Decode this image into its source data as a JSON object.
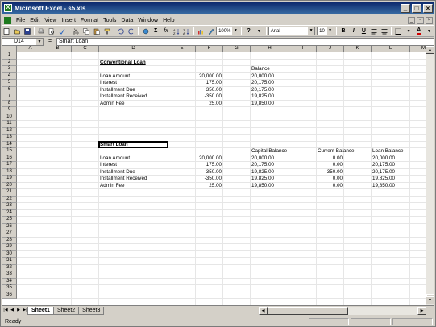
{
  "window": {
    "title": "Microsoft Excel - s5.xls",
    "app_icon": "X"
  },
  "menu": [
    "File",
    "Edit",
    "View",
    "Insert",
    "Format",
    "Tools",
    "Data",
    "Window",
    "Help"
  ],
  "toolbar": {
    "zoom": "100%",
    "font": "Arial",
    "size": "10",
    "help": "?"
  },
  "formula": {
    "name_box": "D14",
    "eq": "=",
    "content": "Smart Loan"
  },
  "columns": [
    "A",
    "B",
    "C",
    "D",
    "E",
    "F",
    "G",
    "H",
    "I",
    "J",
    "K",
    "L",
    "M",
    "N"
  ],
  "rows": [
    "1",
    "2",
    "3",
    "4",
    "5",
    "6",
    "7",
    "8",
    "9",
    "10",
    "11",
    "12",
    "13",
    "14",
    "15",
    "16",
    "17",
    "18",
    "19",
    "20",
    "21",
    "22",
    "23",
    "24",
    "25",
    "26",
    "27",
    "28",
    "29",
    "30",
    "31",
    "32",
    "33",
    "34",
    "35",
    "36"
  ],
  "cells": [
    {
      "row": 2,
      "col": "D",
      "text": "Conventional Loan",
      "style": "heading"
    },
    {
      "row": 3,
      "col": "H",
      "text": "Balance",
      "style": "left"
    },
    {
      "row": 4,
      "col": "D",
      "text": "Loan Amount",
      "style": "left"
    },
    {
      "row": 4,
      "col": "F",
      "text": "20,000.00",
      "style": "right"
    },
    {
      "row": 4,
      "col": "H",
      "text": "20,000.00",
      "style": "left"
    },
    {
      "row": 5,
      "col": "D",
      "text": "Interest",
      "style": "left"
    },
    {
      "row": 5,
      "col": "F",
      "text": "175.00",
      "style": "right"
    },
    {
      "row": 5,
      "col": "H",
      "text": "20,175.00",
      "style": "left"
    },
    {
      "row": 6,
      "col": "D",
      "text": "Installment Due",
      "style": "left"
    },
    {
      "row": 6,
      "col": "F",
      "text": "350.00",
      "style": "right"
    },
    {
      "row": 6,
      "col": "H",
      "text": "20,175.00",
      "style": "left"
    },
    {
      "row": 7,
      "col": "D",
      "text": "Installment Received",
      "style": "left"
    },
    {
      "row": 7,
      "col": "F",
      "text": "-350.00",
      "style": "right"
    },
    {
      "row": 7,
      "col": "H",
      "text": "19,825.00",
      "style": "left"
    },
    {
      "row": 8,
      "col": "D",
      "text": "Admin Fee",
      "style": "left"
    },
    {
      "row": 8,
      "col": "F",
      "text": "25.00",
      "style": "right"
    },
    {
      "row": 8,
      "col": "H",
      "text": "19,850.00",
      "style": "left"
    },
    {
      "row": 14,
      "col": "D",
      "text": "Smart Loan",
      "style": "heading"
    },
    {
      "row": 15,
      "col": "H",
      "text": "Capital Balance",
      "style": "left"
    },
    {
      "row": 15,
      "col": "J",
      "text": "Current Balance",
      "style": "left"
    },
    {
      "row": 15,
      "col": "L",
      "text": "Loan Balance",
      "style": "left"
    },
    {
      "row": 16,
      "col": "D",
      "text": "Loan Amount",
      "style": "left"
    },
    {
      "row": 16,
      "col": "F",
      "text": "20,000.00",
      "style": "right"
    },
    {
      "row": 16,
      "col": "H",
      "text": "20,000.00",
      "style": "left"
    },
    {
      "row": 16,
      "col": "J",
      "text": "0.00",
      "style": "right"
    },
    {
      "row": 16,
      "col": "L",
      "text": "20,000.00",
      "style": "left"
    },
    {
      "row": 17,
      "col": "D",
      "text": "Interest",
      "style": "left"
    },
    {
      "row": 17,
      "col": "F",
      "text": "175.00",
      "style": "right"
    },
    {
      "row": 17,
      "col": "H",
      "text": "20,175.00",
      "style": "left"
    },
    {
      "row": 17,
      "col": "J",
      "text": "0.00",
      "style": "right"
    },
    {
      "row": 17,
      "col": "L",
      "text": "20,175.00",
      "style": "left"
    },
    {
      "row": 18,
      "col": "D",
      "text": "Installment Due",
      "style": "left"
    },
    {
      "row": 18,
      "col": "F",
      "text": "350.00",
      "style": "right"
    },
    {
      "row": 18,
      "col": "H",
      "text": "19,825.00",
      "style": "left"
    },
    {
      "row": 18,
      "col": "J",
      "text": "350.00",
      "style": "right"
    },
    {
      "row": 18,
      "col": "L",
      "text": "20,175.00",
      "style": "left"
    },
    {
      "row": 19,
      "col": "D",
      "text": "Installment Received",
      "style": "left"
    },
    {
      "row": 19,
      "col": "F",
      "text": "-350.00",
      "style": "right"
    },
    {
      "row": 19,
      "col": "H",
      "text": "19,825.00",
      "style": "left"
    },
    {
      "row": 19,
      "col": "J",
      "text": "0.00",
      "style": "right"
    },
    {
      "row": 19,
      "col": "L",
      "text": "19,825.00",
      "style": "left"
    },
    {
      "row": 20,
      "col": "D",
      "text": "Admin Fee",
      "style": "left"
    },
    {
      "row": 20,
      "col": "F",
      "text": "25.00",
      "style": "right"
    },
    {
      "row": 20,
      "col": "H",
      "text": "19,850.00",
      "style": "left"
    },
    {
      "row": 20,
      "col": "J",
      "text": "0.00",
      "style": "right"
    },
    {
      "row": 20,
      "col": "L",
      "text": "19,850.00",
      "style": "left"
    }
  ],
  "selected_cell": {
    "row": 14,
    "col": "D"
  },
  "sheets": [
    {
      "name": "Sheet1",
      "active": true
    },
    {
      "name": "Sheet2",
      "active": false
    },
    {
      "name": "Sheet3",
      "active": false
    }
  ],
  "status": "Ready",
  "colors": {
    "title_start": "#0a246a",
    "title_end": "#3a6ea5",
    "excel_green": "#1e7a1e"
  }
}
